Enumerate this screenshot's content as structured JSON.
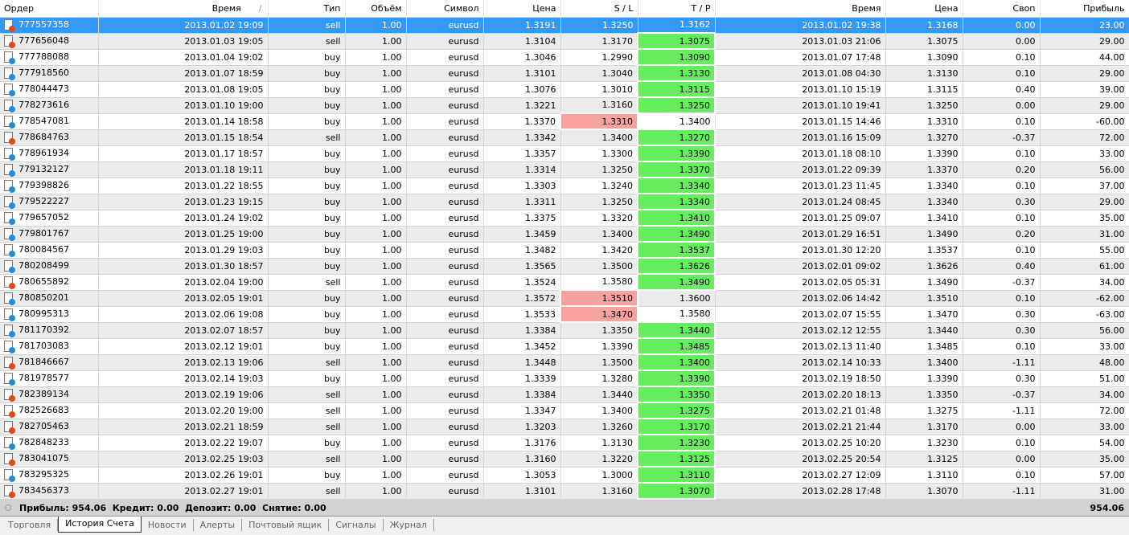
{
  "columns": [
    "Ордер",
    "Время",
    "Тип",
    "Объём",
    "Символ",
    "Цена",
    "S / L",
    "T / P",
    "Время",
    "Цена",
    "Своп",
    "Прибыль"
  ],
  "sort_indicator": "/",
  "colors": {
    "selected": "#3399ff",
    "tp_hit": "#66ee5e",
    "sl_hit": "#f9a0a0",
    "sell_icon": "#e0481c",
    "buy_icon": "#2a8ad8"
  },
  "rows": [
    [
      "777557358",
      "2013.01.02 19:09",
      "sell",
      "1.00",
      "eurusd",
      "1.3191",
      "1.3250",
      "1.3162",
      "2013.01.02 19:38",
      "1.3168",
      "0.00",
      "23.00",
      ""
    ],
    [
      "777656048",
      "2013.01.03 19:05",
      "sell",
      "1.00",
      "eurusd",
      "1.3104",
      "1.3170",
      "1.3075",
      "2013.01.03 21:06",
      "1.3075",
      "0.00",
      "29.00",
      "tp"
    ],
    [
      "777788088",
      "2013.01.04 19:02",
      "buy",
      "1.00",
      "eurusd",
      "1.3046",
      "1.2990",
      "1.3090",
      "2013.01.07 17:48",
      "1.3090",
      "0.10",
      "44.00",
      "tp"
    ],
    [
      "777918560",
      "2013.01.07 18:59",
      "buy",
      "1.00",
      "eurusd",
      "1.3101",
      "1.3040",
      "1.3130",
      "2013.01.08 04:30",
      "1.3130",
      "0.10",
      "29.00",
      "tp"
    ],
    [
      "778044473",
      "2013.01.08 19:05",
      "buy",
      "1.00",
      "eurusd",
      "1.3076",
      "1.3010",
      "1.3115",
      "2013.01.10 15:19",
      "1.3115",
      "0.40",
      "39.00",
      "tp"
    ],
    [
      "778273616",
      "2013.01.10 19:00",
      "buy",
      "1.00",
      "eurusd",
      "1.3221",
      "1.3160",
      "1.3250",
      "2013.01.10 19:41",
      "1.3250",
      "0.00",
      "29.00",
      "tp"
    ],
    [
      "778547081",
      "2013.01.14 18:58",
      "buy",
      "1.00",
      "eurusd",
      "1.3370",
      "1.3310",
      "1.3400",
      "2013.01.15 14:46",
      "1.3310",
      "0.10",
      "-60.00",
      "sl"
    ],
    [
      "778684763",
      "2013.01.15 18:54",
      "sell",
      "1.00",
      "eurusd",
      "1.3342",
      "1.3400",
      "1.3270",
      "2013.01.16 15:09",
      "1.3270",
      "-0.37",
      "72.00",
      "tp"
    ],
    [
      "778961934",
      "2013.01.17 18:57",
      "buy",
      "1.00",
      "eurusd",
      "1.3357",
      "1.3300",
      "1.3390",
      "2013.01.18 08:10",
      "1.3390",
      "0.10",
      "33.00",
      "tp"
    ],
    [
      "779132127",
      "2013.01.18 19:11",
      "buy",
      "1.00",
      "eurusd",
      "1.3314",
      "1.3250",
      "1.3370",
      "2013.01.22 09:39",
      "1.3370",
      "0.20",
      "56.00",
      "tp"
    ],
    [
      "779398826",
      "2013.01.22 18:55",
      "buy",
      "1.00",
      "eurusd",
      "1.3303",
      "1.3240",
      "1.3340",
      "2013.01.23 11:45",
      "1.3340",
      "0.10",
      "37.00",
      "tp"
    ],
    [
      "779522227",
      "2013.01.23 19:15",
      "buy",
      "1.00",
      "eurusd",
      "1.3311",
      "1.3250",
      "1.3340",
      "2013.01.24 08:45",
      "1.3340",
      "0.30",
      "29.00",
      "tp"
    ],
    [
      "779657052",
      "2013.01.24 19:02",
      "buy",
      "1.00",
      "eurusd",
      "1.3375",
      "1.3320",
      "1.3410",
      "2013.01.25 09:07",
      "1.3410",
      "0.10",
      "35.00",
      "tp"
    ],
    [
      "779801767",
      "2013.01.25 19:00",
      "buy",
      "1.00",
      "eurusd",
      "1.3459",
      "1.3400",
      "1.3490",
      "2013.01.29 16:51",
      "1.3490",
      "0.20",
      "31.00",
      "tp"
    ],
    [
      "780084567",
      "2013.01.29 19:03",
      "buy",
      "1.00",
      "eurusd",
      "1.3482",
      "1.3420",
      "1.3537",
      "2013.01.30 12:20",
      "1.3537",
      "0.10",
      "55.00",
      "tp"
    ],
    [
      "780208499",
      "2013.01.30 18:57",
      "buy",
      "1.00",
      "eurusd",
      "1.3565",
      "1.3500",
      "1.3626",
      "2013.02.01 09:02",
      "1.3626",
      "0.40",
      "61.00",
      "tp"
    ],
    [
      "780655892",
      "2013.02.04 19:00",
      "sell",
      "1.00",
      "eurusd",
      "1.3524",
      "1.3580",
      "1.3490",
      "2013.02.05 05:31",
      "1.3490",
      "-0.37",
      "34.00",
      "tp"
    ],
    [
      "780850201",
      "2013.02.05 19:01",
      "buy",
      "1.00",
      "eurusd",
      "1.3572",
      "1.3510",
      "1.3600",
      "2013.02.06 14:42",
      "1.3510",
      "0.10",
      "-62.00",
      "sl"
    ],
    [
      "780995313",
      "2013.02.06 19:08",
      "buy",
      "1.00",
      "eurusd",
      "1.3533",
      "1.3470",
      "1.3580",
      "2013.02.07 15:55",
      "1.3470",
      "0.30",
      "-63.00",
      "sl"
    ],
    [
      "781170392",
      "2013.02.07 18:57",
      "buy",
      "1.00",
      "eurusd",
      "1.3384",
      "1.3350",
      "1.3440",
      "2013.02.12 12:55",
      "1.3440",
      "0.30",
      "56.00",
      "tp"
    ],
    [
      "781703083",
      "2013.02.12 19:01",
      "buy",
      "1.00",
      "eurusd",
      "1.3452",
      "1.3390",
      "1.3485",
      "2013.02.13 11:40",
      "1.3485",
      "0.10",
      "33.00",
      "tp"
    ],
    [
      "781846667",
      "2013.02.13 19:06",
      "sell",
      "1.00",
      "eurusd",
      "1.3448",
      "1.3500",
      "1.3400",
      "2013.02.14 10:33",
      "1.3400",
      "-1.11",
      "48.00",
      "tp"
    ],
    [
      "781978577",
      "2013.02.14 19:03",
      "buy",
      "1.00",
      "eurusd",
      "1.3339",
      "1.3280",
      "1.3390",
      "2013.02.19 18:50",
      "1.3390",
      "0.30",
      "51.00",
      "tp"
    ],
    [
      "782389134",
      "2013.02.19 19:06",
      "sell",
      "1.00",
      "eurusd",
      "1.3384",
      "1.3440",
      "1.3350",
      "2013.02.20 18:13",
      "1.3350",
      "-0.37",
      "34.00",
      "tp"
    ],
    [
      "782526683",
      "2013.02.20 19:00",
      "sell",
      "1.00",
      "eurusd",
      "1.3347",
      "1.3400",
      "1.3275",
      "2013.02.21 01:48",
      "1.3275",
      "-1.11",
      "72.00",
      "tp"
    ],
    [
      "782705463",
      "2013.02.21 18:59",
      "sell",
      "1.00",
      "eurusd",
      "1.3203",
      "1.3260",
      "1.3170",
      "2013.02.21 21:44",
      "1.3170",
      "0.00",
      "33.00",
      "tp"
    ],
    [
      "782848233",
      "2013.02.22 19:07",
      "buy",
      "1.00",
      "eurusd",
      "1.3176",
      "1.3130",
      "1.3230",
      "2013.02.25 10:20",
      "1.3230",
      "0.10",
      "54.00",
      "tp"
    ],
    [
      "783041075",
      "2013.02.25 19:03",
      "sell",
      "1.00",
      "eurusd",
      "1.3160",
      "1.3220",
      "1.3125",
      "2013.02.25 20:54",
      "1.3125",
      "0.00",
      "35.00",
      "tp"
    ],
    [
      "783295325",
      "2013.02.26 19:01",
      "buy",
      "1.00",
      "eurusd",
      "1.3053",
      "1.3000",
      "1.3110",
      "2013.02.27 12:09",
      "1.3110",
      "0.10",
      "57.00",
      "tp"
    ],
    [
      "783456373",
      "2013.02.27 19:01",
      "sell",
      "1.00",
      "eurusd",
      "1.3101",
      "1.3160",
      "1.3070",
      "2013.02.28 17:48",
      "1.3070",
      "-1.11",
      "31.00",
      "tp"
    ]
  ],
  "selected_row": 0,
  "footer": {
    "summary": "Прибыль: 954.06  Кредит: 0.00  Депозит: 0.00  Снятие: 0.00",
    "total": "954.06"
  },
  "tabs": [
    "Торговля",
    "История Счета",
    "Новости",
    "Алерты",
    "Почтовый ящик",
    "Сигналы",
    "Журнал"
  ],
  "active_tab": 1
}
